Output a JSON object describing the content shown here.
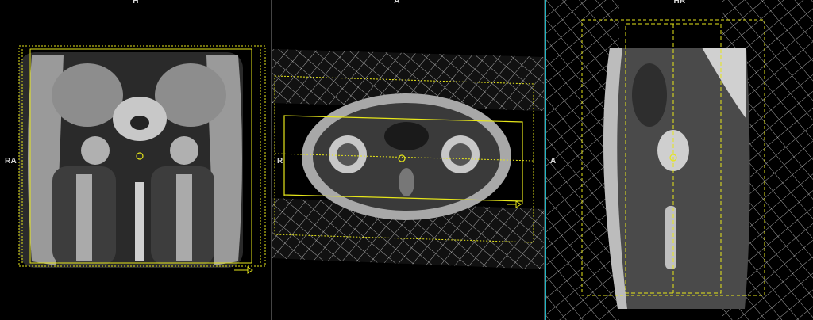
{
  "viewports": {
    "coronal": {
      "top_label": "H",
      "left_label": "RA"
    },
    "axial": {
      "top_label": "A",
      "left_label": "R"
    },
    "sagittal": {
      "top_label": "HR",
      "left_label": "A"
    }
  },
  "colors": {
    "planning_box": "#e6e61a",
    "saturation_band": "#cfcfcf",
    "active_border": "#1fb7c4",
    "label_text": "#d8d8d8"
  },
  "icons": {
    "center_marker": "circle-target-icon",
    "direction_arrow": "arrow-right-icon"
  }
}
